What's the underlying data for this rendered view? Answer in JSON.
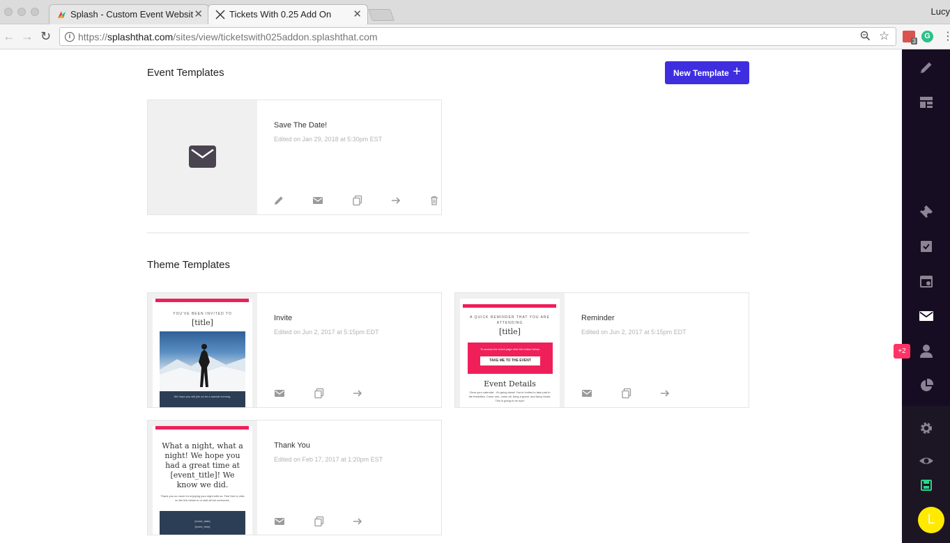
{
  "browser": {
    "tabs": [
      {
        "title": "Splash - Custom Event Websit",
        "close": "✕"
      },
      {
        "title": "Tickets With 0.25 Add On",
        "close": "✕"
      }
    ],
    "user": "Lucy",
    "url_prefix": "https://",
    "url_domain": "splashthat.com",
    "url_path": "/sites/view/ticketswith025addon.splashthat.com",
    "ext_badge_count": "3",
    "ext_g_label": "G"
  },
  "header": {
    "event_templates_title": "Event Templates",
    "new_template_label": "New Template",
    "theme_templates_title": "Theme Templates"
  },
  "event_templates": [
    {
      "title": "Save The Date!",
      "edited": "Edited on Jan 29, 2018 at 5:30pm EST"
    }
  ],
  "theme_templates": [
    {
      "title": "Invite",
      "edited": "Edited on Jun 2, 2017 at 5:15pm EDT",
      "thumb_kicker": "YOU'VE BEEN INVITED TO",
      "thumb_title": "[title]",
      "thumb_footer": "We hope you will join us for a special evening."
    },
    {
      "title": "Reminder",
      "edited": "Edited on Jun 2, 2017 at 5:15pm EDT",
      "thumb_kicker": "A QUICK REMINDER THAT YOU ARE ATTENDING",
      "thumb_title": "[title]",
      "thumb_cta_text": "To access the event page click the button below.",
      "thumb_cta_button": "TAKE ME TO THE EVENT",
      "thumb_section": "Event Details",
      "thumb_body": "Clear your calendar - it's going down! You're invited to take part in the festivities. Come one, come all, bring a guest, and fancy boots. This is going to be epic!"
    },
    {
      "title": "Thank You",
      "edited": "Edited on Feb 17, 2017 at 1:20pm EST",
      "thumb_heading": "What a night, what a night! We hope you had a great time at [event_title]! We know we did.",
      "thumb_body": "Thank you so much for enjoying your night with us. Feel free to click on the link below to re-visit all the memories.",
      "thumb_date": "[event_date]",
      "thumb_time": "[event_time]"
    }
  ],
  "sidebar": {
    "notification_badge": "+2",
    "avatar_initial": "L"
  },
  "colors": {
    "primary_button": "#3f2ee0",
    "sidebar_bg": "#170d22",
    "accent_red": "#ef1f5a",
    "save_green": "#2bd28a",
    "avatar_yellow": "#ffea00"
  }
}
